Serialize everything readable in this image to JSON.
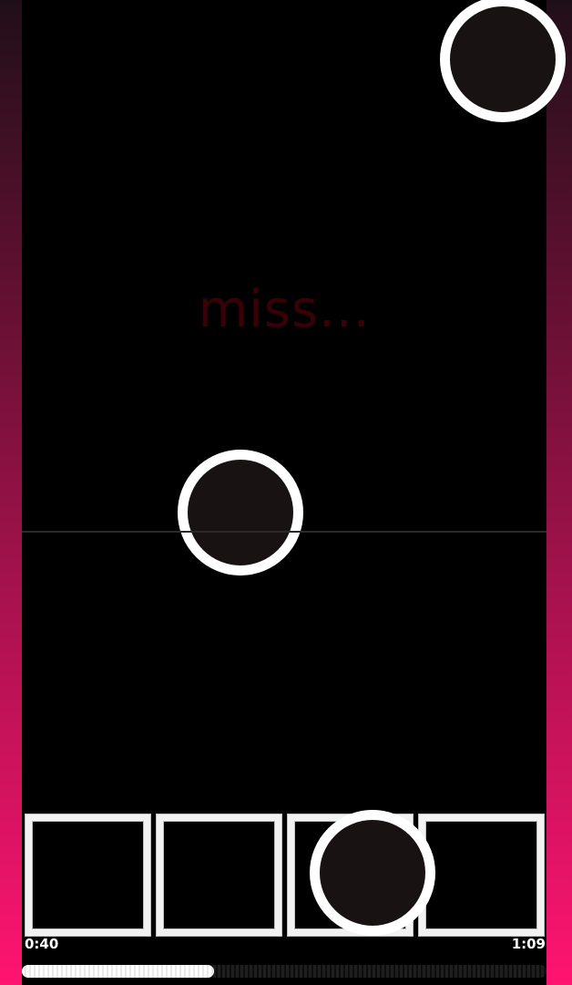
{
  "game": {
    "judgement_text": "miss...",
    "time_elapsed": "0:40",
    "time_total": "1:09",
    "progress_fraction": 0.367,
    "lanes": 4,
    "falling_notes": [
      {
        "lane": 3,
        "y_track_fraction": 0.06
      },
      {
        "lane": 1,
        "y_track_fraction": 0.52
      }
    ],
    "note_at_target_lane": 2
  },
  "colors": {
    "background": "#000000",
    "side_gradient_top": "#200f18",
    "side_gradient_bottom": "#ff1470",
    "note_fill": "#181212",
    "note_ring": "#ffffff",
    "judgement_color": "#3a0008",
    "target_border": "#f2f2f2"
  },
  "icons": {
    "note": "circle-note-icon",
    "target": "square-target-icon"
  }
}
